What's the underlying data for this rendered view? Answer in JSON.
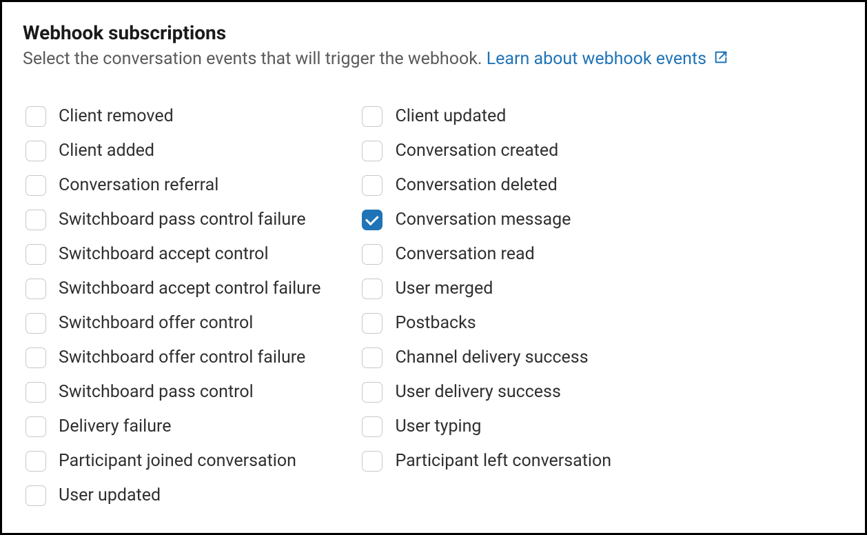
{
  "panel": {
    "title": "Webhook subscriptions",
    "description": "Select the conversation events that will trigger the webhook.",
    "learn_link": "Learn about webhook events"
  },
  "columns": [
    [
      {
        "label": "Client removed",
        "checked": false
      },
      {
        "label": "Client added",
        "checked": false
      },
      {
        "label": "Conversation referral",
        "checked": false
      },
      {
        "label": "Switchboard pass control failure",
        "checked": false
      },
      {
        "label": "Switchboard accept control",
        "checked": false
      },
      {
        "label": "Switchboard accept control failure",
        "checked": false
      },
      {
        "label": "Switchboard offer control",
        "checked": false
      },
      {
        "label": "Switchboard offer control failure",
        "checked": false
      },
      {
        "label": "Switchboard pass control",
        "checked": false
      },
      {
        "label": "Delivery failure",
        "checked": false
      },
      {
        "label": "Participant joined conversation",
        "checked": false
      },
      {
        "label": "User updated",
        "checked": false
      }
    ],
    [
      {
        "label": "Client updated",
        "checked": false
      },
      {
        "label": "Conversation created",
        "checked": false
      },
      {
        "label": "Conversation deleted",
        "checked": false
      },
      {
        "label": "Conversation message",
        "checked": true
      },
      {
        "label": "Conversation read",
        "checked": false
      },
      {
        "label": "User merged",
        "checked": false
      },
      {
        "label": "Postbacks",
        "checked": false
      },
      {
        "label": "Channel delivery success",
        "checked": false
      },
      {
        "label": "User delivery success",
        "checked": false
      },
      {
        "label": "User typing",
        "checked": false
      },
      {
        "label": "Participant left conversation",
        "checked": false
      }
    ]
  ]
}
